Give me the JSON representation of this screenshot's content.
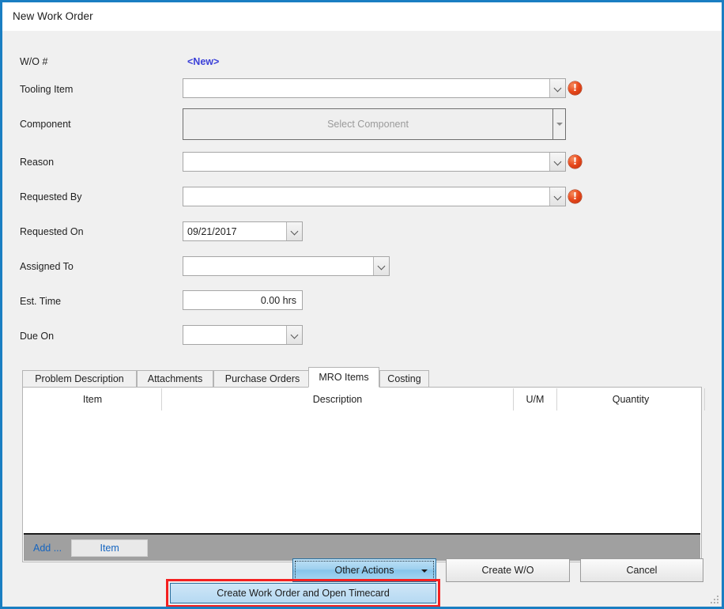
{
  "window": {
    "title": "New Work Order",
    "accent_color": "#1a7ec2",
    "body_background": "#f0f0f0"
  },
  "form": {
    "rows": [
      {
        "label": "W/O #",
        "value": "<New>"
      },
      {
        "label": "Tooling Item",
        "value": ""
      },
      {
        "label": "Component",
        "value": "Select Component"
      },
      {
        "label": "Reason",
        "value": ""
      },
      {
        "label": "Requested By",
        "value": ""
      },
      {
        "label": "Requested On",
        "value": "09/21/2017"
      },
      {
        "label": "Assigned To",
        "value": ""
      },
      {
        "label": "Est. Time",
        "value": "0.00 hrs"
      },
      {
        "label": "Due On",
        "value": ""
      }
    ],
    "error_glyph": "!",
    "error_color": "#e8481b",
    "new_value_color": "#3b40d8"
  },
  "tabs": {
    "items": [
      {
        "label": "Problem Description",
        "active": false
      },
      {
        "label": "Attachments",
        "active": false
      },
      {
        "label": "Purchase Orders",
        "active": false
      },
      {
        "label": "MRO Items",
        "active": true
      },
      {
        "label": "Costing",
        "active": false
      }
    ]
  },
  "grid": {
    "columns": [
      "Item",
      "Description",
      "U/M",
      "Quantity"
    ],
    "rows": [],
    "footer": {
      "add_label": "Add ...",
      "item_button_label": "Item",
      "background": "#a0a0a0",
      "link_color": "#1565c0"
    }
  },
  "footer_buttons": {
    "other_actions": "Other Actions",
    "create_wo": "Create W/O",
    "cancel": "Cancel"
  },
  "dropdown_menu": {
    "items": [
      {
        "label": "Create Work Order and Open Timecard",
        "highlighted": true
      }
    ],
    "annotation_color": "#f42020"
  }
}
